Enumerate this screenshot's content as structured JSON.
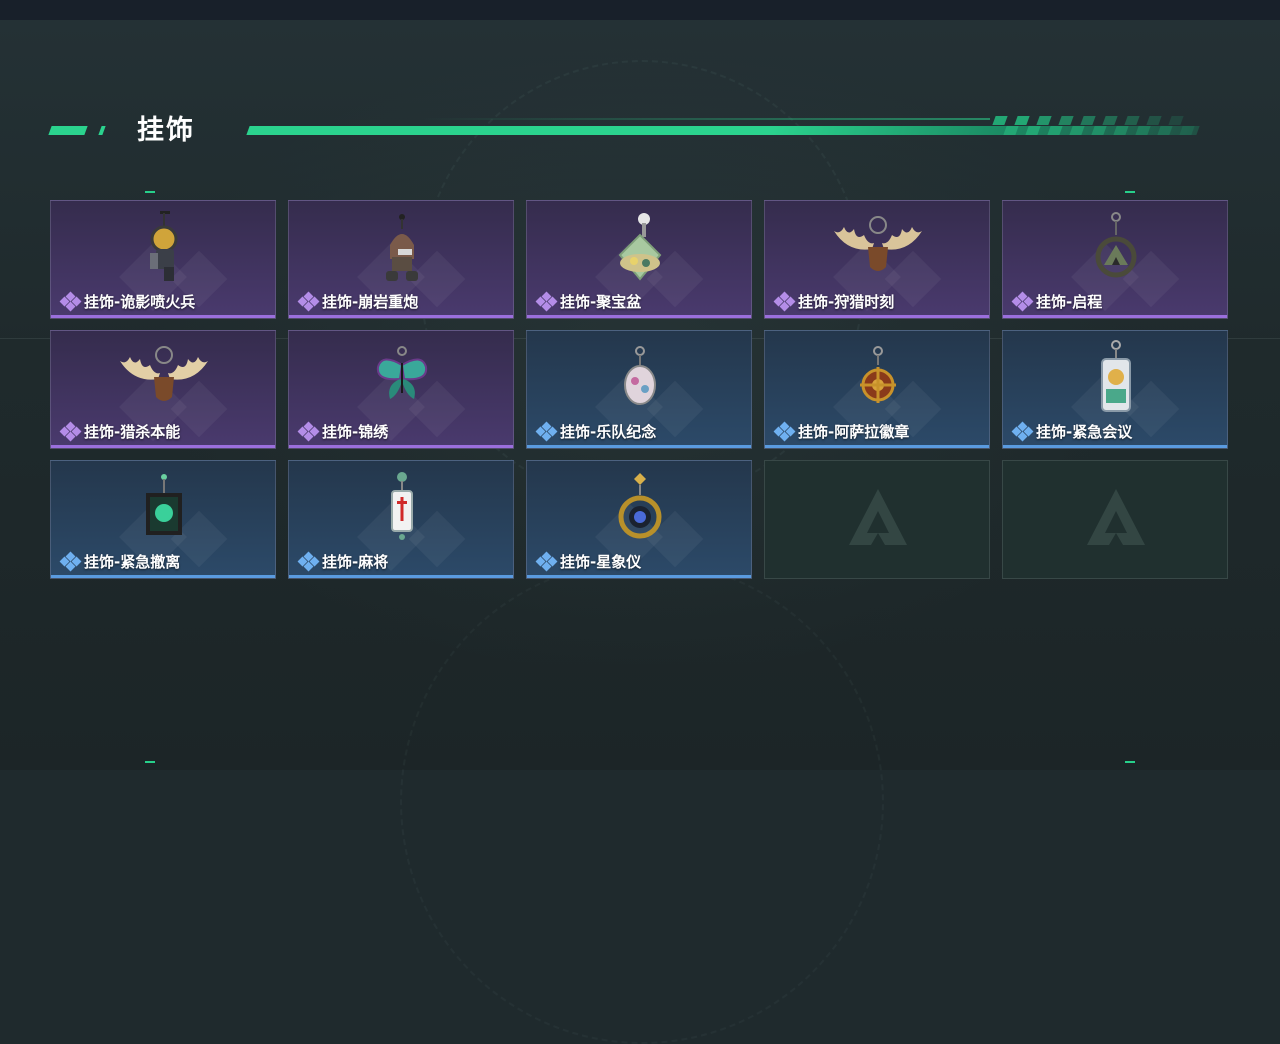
{
  "section": {
    "title": "挂饰"
  },
  "colors": {
    "accent_green": "#2bd38e",
    "rarity_purple": "#9b6fdd",
    "rarity_blue": "#5a9be0"
  },
  "items": [
    {
      "label": "挂饰-诡影喷火兵",
      "rarity": "purple",
      "icon": "flamethrower-soldier-charm-icon"
    },
    {
      "label": "挂饰-崩岩重炮",
      "rarity": "purple",
      "icon": "heavy-gunner-charm-icon"
    },
    {
      "label": "挂饰-聚宝盆",
      "rarity": "purple",
      "icon": "treasure-bowl-charm-icon"
    },
    {
      "label": "挂饰-狩猎时刻",
      "rarity": "purple",
      "icon": "moose-antlers-charm-icon"
    },
    {
      "label": "挂饰-启程",
      "rarity": "purple",
      "icon": "mountain-ring-charm-icon"
    },
    {
      "label": "挂饰-猎杀本能",
      "rarity": "purple",
      "icon": "moose-antlers-charm-icon"
    },
    {
      "label": "挂饰-锦绣",
      "rarity": "purple",
      "icon": "butterfly-charm-icon"
    },
    {
      "label": "挂饰-乐队纪念",
      "rarity": "blue",
      "icon": "band-badge-charm-icon"
    },
    {
      "label": "挂饰-阿萨拉徽章",
      "rarity": "blue",
      "icon": "asala-emblem-charm-icon"
    },
    {
      "label": "挂饰-紧急会议",
      "rarity": "blue",
      "icon": "emergency-meeting-charm-icon"
    },
    {
      "label": "挂饰-紧急撤离",
      "rarity": "blue",
      "icon": "emergency-exit-charm-icon"
    },
    {
      "label": "挂饰-麻将",
      "rarity": "blue",
      "icon": "mahjong-tile-charm-icon"
    },
    {
      "label": "挂饰-星象仪",
      "rarity": "blue",
      "icon": "astrolabe-charm-icon"
    },
    {
      "label": "",
      "rarity": "empty",
      "icon": "empty-slot-logo-icon"
    },
    {
      "label": "",
      "rarity": "empty",
      "icon": "empty-slot-logo-icon"
    }
  ]
}
